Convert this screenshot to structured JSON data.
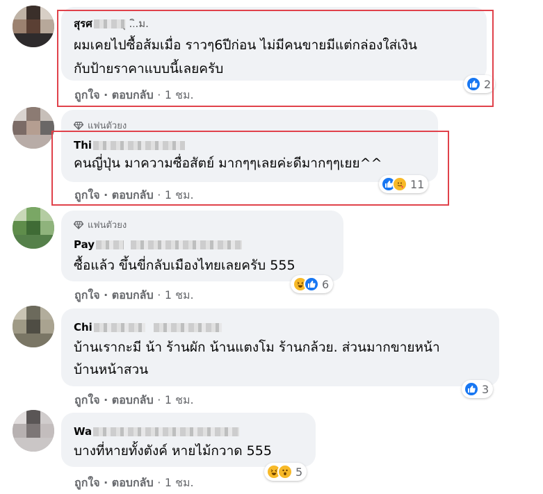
{
  "comments": [
    {
      "name_visible": "สุรศ",
      "name_suffix": "ุ ..ิ.ม.",
      "badge": "",
      "text_lines": [
        "ผมเคยไปซื้อส้มเมื่อ ราวๆ6ปีก่อน ไม่มีคนขายมีแต่กล่องใส่เงิน",
        "กับป้ายราคาแบบนี้เลยครับ"
      ],
      "like": "ถูกใจ",
      "reply": "ตอบกลับ",
      "time": "1 ชม.",
      "reactions": [
        "like"
      ],
      "reaction_count": "2"
    },
    {
      "name_visible": "Thi",
      "name_suffix": "",
      "badge": "แฟนตัวยง",
      "text_lines": [
        "คนญี่ปุ่น มาความซื่อสัตย์ มากๆๆเลยค่ะดีมากๆๆเยย^^"
      ],
      "like": "ถูกใจ",
      "reply": "ตอบกลับ",
      "time": "1 ชม.",
      "reactions": [
        "like",
        "care"
      ],
      "reaction_count": "11"
    },
    {
      "name_visible": "Pay",
      "name_suffix": "",
      "badge": "แฟนตัวยง",
      "text_lines": [
        "ซื้อแล้ว ขึ้นขี่กลับเมืองไทยเลยครับ 555"
      ],
      "like": "ถูกใจ",
      "reply": "ตอบกลับ",
      "time": "1 ชม.",
      "reactions": [
        "haha",
        "like"
      ],
      "reaction_count": "6"
    },
    {
      "name_visible": "Chi",
      "name_suffix": "",
      "badge": "",
      "text_lines": [
        "บ้านเรากะมี น้า ร้านผัก น้านแตงโม ร้านกล้วย. ส่วนมากขายหน้า",
        "บ้านหน้าสวน"
      ],
      "like": "ถูกใจ",
      "reply": "ตอบกลับ",
      "time": "1 ชม.",
      "reactions": [
        "like"
      ],
      "reaction_count": "3"
    },
    {
      "name_visible": "Wa",
      "name_suffix": "",
      "badge": "",
      "text_lines": [
        "บางที่หายทั้งตังค์ หายไม้กวาด 555"
      ],
      "like": "ถูกใจ",
      "reply": "ตอบกลับ",
      "time": "1 ชม.",
      "reactions": [
        "haha",
        "wow"
      ],
      "reaction_count": "5"
    }
  ],
  "separator": "·",
  "colors": {
    "like_blue": "#1877f2",
    "highlight_red": "#e0414a",
    "bubble_gray": "#f0f2f5",
    "meta_gray": "#65676b"
  }
}
